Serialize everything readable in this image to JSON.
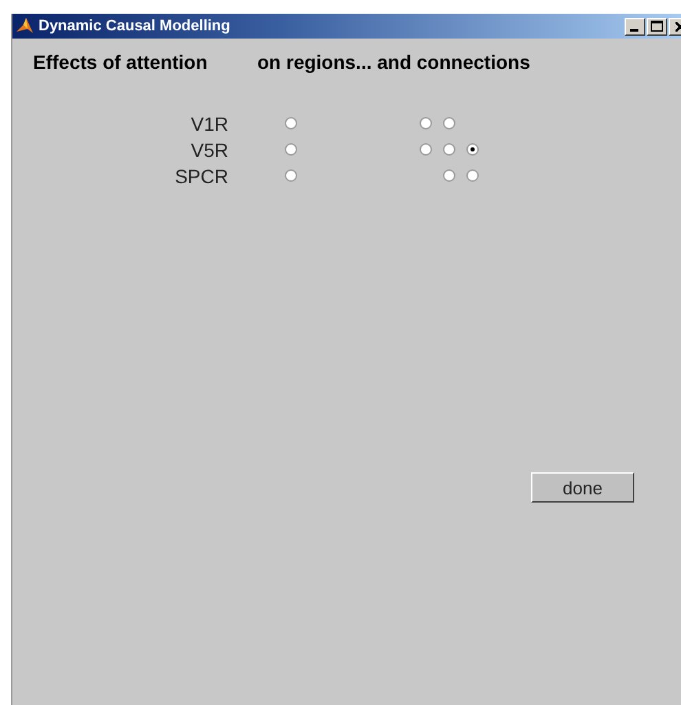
{
  "window": {
    "title": "Dynamic Causal Modelling"
  },
  "headings": [
    "Effects of attention",
    "on regions... and connections"
  ],
  "rows": [
    {
      "label": "V1R",
      "region": {
        "selected": false
      },
      "connections": [
        {
          "kind": "radio",
          "selected": false
        },
        {
          "kind": "radio",
          "selected": false
        },
        {
          "kind": "none"
        }
      ]
    },
    {
      "label": "V5R",
      "region": {
        "selected": false
      },
      "connections": [
        {
          "kind": "radio",
          "selected": false
        },
        {
          "kind": "radio",
          "selected": false
        },
        {
          "kind": "radio",
          "selected": true
        }
      ]
    },
    {
      "label": "SPCR",
      "region": {
        "selected": false
      },
      "connections": [
        {
          "kind": "none"
        },
        {
          "kind": "radio",
          "selected": false
        },
        {
          "kind": "radio",
          "selected": false
        }
      ]
    }
  ],
  "buttons": [
    "done"
  ]
}
